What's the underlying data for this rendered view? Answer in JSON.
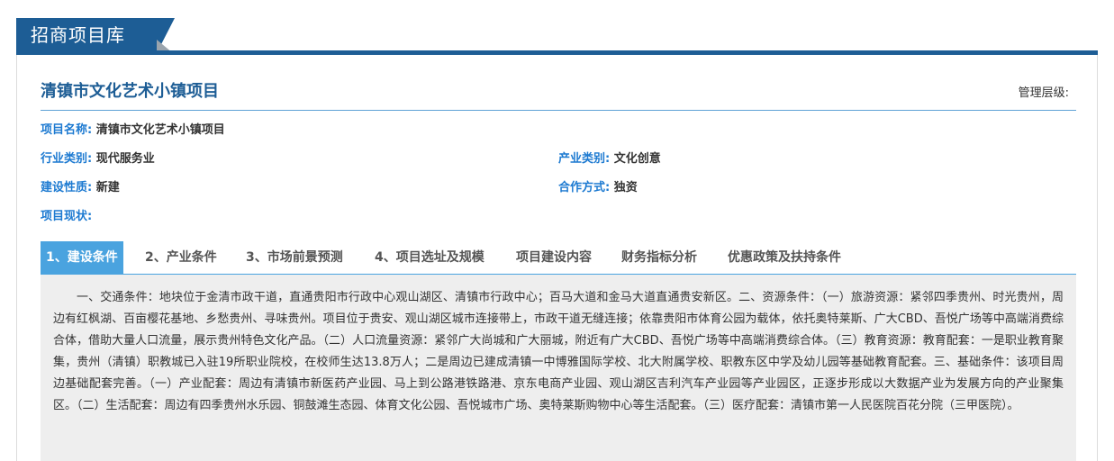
{
  "header": {
    "title": "招商项目库"
  },
  "project": {
    "title": "清镇市文化艺术小镇项目",
    "management_level_label": "管理层级:",
    "fields": {
      "name_label": "项目名称:",
      "name_value": "清镇市文化艺术小镇项目",
      "industry_label": "行业类别:",
      "industry_value": "现代服务业",
      "product_label": "产业类别:",
      "product_value": "文化创意",
      "nature_label": "建设性质:",
      "nature_value": "新建",
      "cooperation_label": "合作方式:",
      "cooperation_value": "独资",
      "status_label": "项目现状:",
      "status_value": ""
    }
  },
  "tabs": [
    {
      "label": "1、建设条件",
      "active": true
    },
    {
      "label": "2、产业条件",
      "active": false
    },
    {
      "label": "3、市场前景预测",
      "active": false
    },
    {
      "label": "4、项目选址及规模",
      "active": false
    },
    {
      "label": "项目建设内容",
      "active": false
    },
    {
      "label": "财务指标分析",
      "active": false
    },
    {
      "label": "优惠政策及扶持条件",
      "active": false
    }
  ],
  "content": {
    "text": "一、交通条件：地块位于金清市政干道，直通贵阳市行政中心观山湖区、清镇市行政中心；百马大道和金马大道直通贵安新区。二、资源条件：（一）旅游资源：紧邻四季贵州、时光贵州，周边有红枫湖、百亩樱花基地、乡愁贵州、寻味贵州。项目位于贵安、观山湖区城市连接带上，市政干道无缝连接；依靠贵阳市体育公园为载体，依托奥特莱斯、广大CBD、吾悦广场等中高端消费综合体，借助大量人口流量，展示贵州特色文化产品。（二）人口流量资源：紧邻广大尚城和广大丽城，附近有广大CBD、吾悦广场等中高端消费综合体。（三）教育资源：教育配套：一是职业教育聚集，贵州（清镇）职教城已入驻19所职业院校，在校师生达13.8万人；二是周边已建成清镇一中博雅国际学校、北大附属学校、职教东区中学及幼儿园等基础教育配套。三、基础条件：该项目周边基础配套完善。（一）产业配套：周边有清镇市新医药产业园、马上到公路港铁路港、京东电商产业园、观山湖区吉利汽车产业园等产业园区，正逐步形成以大数据产业为发展方向的产业聚集区。（二）生活配套：周边有四季贵州水乐园、铜鼓滩生态园、体育文化公园、吾悦城市广场、奥特莱斯购物中心等生活配套。（三）医疗配套：清镇市第一人民医院百花分院（三甲医院）。"
  },
  "colors": {
    "brand": "#1d5d95",
    "accent": "#4aa3df",
    "label": "#1d7ad1"
  }
}
